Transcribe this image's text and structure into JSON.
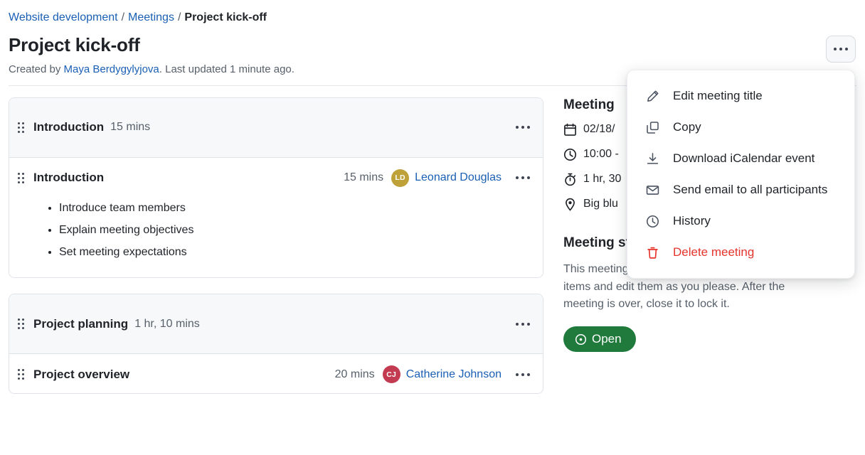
{
  "breadcrumb": {
    "items": [
      {
        "label": "Website development",
        "link": true
      },
      {
        "label": "Meetings",
        "link": true
      },
      {
        "label": "Project kick-off",
        "link": false
      }
    ],
    "separator": "/"
  },
  "header": {
    "title": "Project kick-off",
    "created_prefix": "Created by ",
    "author": "Maya Berdygylyjova",
    "updated_text": ". Last updated 1 minute ago.",
    "kebab_icon": "ellipsis-icon"
  },
  "menu": {
    "items": [
      {
        "label": "Edit meeting title",
        "icon": "pencil-icon",
        "danger": false
      },
      {
        "label": "Copy",
        "icon": "copy-icon",
        "danger": false
      },
      {
        "label": "Download iCalendar event",
        "icon": "download-icon",
        "danger": false
      },
      {
        "label": "Send email to all participants",
        "icon": "envelope-icon",
        "danger": false
      },
      {
        "label": "History",
        "icon": "clock-icon",
        "danger": false
      },
      {
        "label": "Delete meeting",
        "icon": "trash-icon",
        "danger": true
      }
    ]
  },
  "agenda": {
    "sections": [
      {
        "title": "Introduction",
        "duration": "15 mins",
        "items": [
          {
            "title": "Introduction",
            "duration": "15 mins",
            "owner": "Leonard Douglas",
            "initials": "LD",
            "avatar_color": "#bfa13a",
            "bullets": [
              "Introduce team members",
              "Explain meeting objectives",
              "Set meeting expectations"
            ]
          }
        ]
      },
      {
        "title": "Project planning",
        "duration": "1 hr, 10 mins",
        "items": [
          {
            "title": "Project overview",
            "duration": "20 mins",
            "owner": "Catherine Johnson",
            "initials": "CJ",
            "avatar_color": "#c23b50",
            "bullets": []
          }
        ]
      }
    ]
  },
  "side": {
    "details_heading": "Meeting",
    "details": [
      {
        "icon": "calendar-icon",
        "value": "02/18/"
      },
      {
        "icon": "clock-icon",
        "value": "10:00 -"
      },
      {
        "icon": "stopwatch-icon",
        "value": "1 hr, 30"
      },
      {
        "icon": "location-pin-icon",
        "value": "Big blu"
      }
    ],
    "status_heading": "Meeting status",
    "status_text": "This meeting is open. You can add/remove agenda items and edit them as you please. After the meeting is over, close it to lock it.",
    "status_badge": {
      "label": "Open",
      "icon": "dot-circle-icon",
      "color": "#1f7a3c"
    }
  },
  "colors": {
    "link": "#1a5fb4",
    "muted": "#57606a",
    "danger": "#e5342c",
    "card_border": "#dfe3e8",
    "header_bg": "#f7f8fa"
  }
}
